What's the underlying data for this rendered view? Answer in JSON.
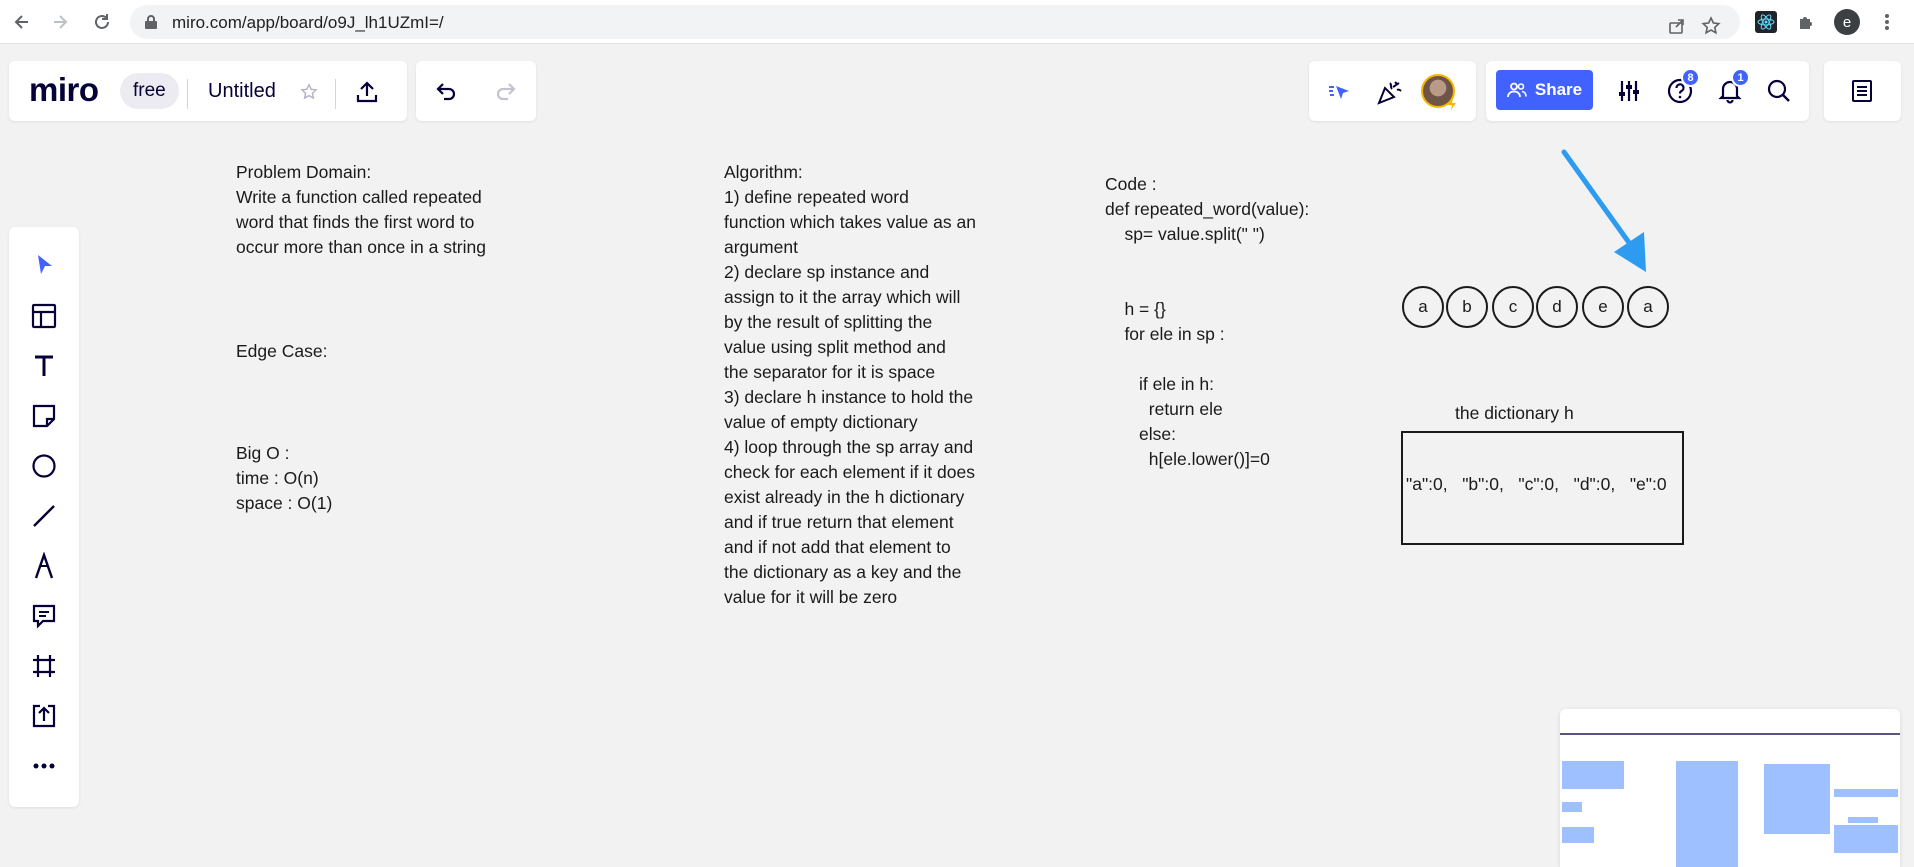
{
  "browser": {
    "url": "miro.com/app/board/o9J_lh1UZmI=/",
    "profile_initial": "e"
  },
  "topbar": {
    "logo": "miro",
    "plan": "free",
    "board_title": "Untitled",
    "share_label": "Share",
    "help_badge": "8",
    "notifications_badge": "1"
  },
  "board": {
    "problem": {
      "lines": [
        "Problem Domain:",
        "Write a function called repeated",
        "word that finds the first word to",
        "occur more than once in a string"
      ]
    },
    "edge_case": "Edge Case:",
    "big_o": {
      "lines": [
        "Big O :",
        "time : O(n)",
        "space : O(1)"
      ]
    },
    "algorithm": {
      "lines": [
        "Algorithm:",
        "1) define repeated word",
        "function which takes value as an",
        "argument",
        "2) declare sp instance and",
        "assign to it the array which will",
        "by the result of splitting the",
        "value using split method and",
        "the separator for it is space",
        "3) declare h instance to hold the",
        "value of empty dictionary",
        "4) loop through the sp array and",
        "check for each element if it does",
        "exist already in the h dictionary",
        "and if true return that element",
        "and if not add that element to",
        "the dictionary as a key and the",
        "value for it will be zero"
      ]
    },
    "code": {
      "lines": [
        "Code :",
        "def repeated_word(value):",
        "    sp= value.split(\" \")",
        "",
        "",
        "    h = {}",
        "    for ele in sp :",
        "",
        "       if ele in h:",
        "         return ele",
        "       else:",
        "         h[ele.lower()]=0"
      ]
    },
    "circles": [
      "a",
      "b",
      "c",
      "d",
      "e",
      "a"
    ],
    "dict_label": "the dictionary h",
    "dict_content": "\"a\":0,   \"b\":0,   \"c\":0,   \"d\":0,   \"e\":0",
    "arrow_color": "#2d9bf0"
  },
  "colors": {
    "accent": "#4262ff",
    "ink": "#050038"
  }
}
